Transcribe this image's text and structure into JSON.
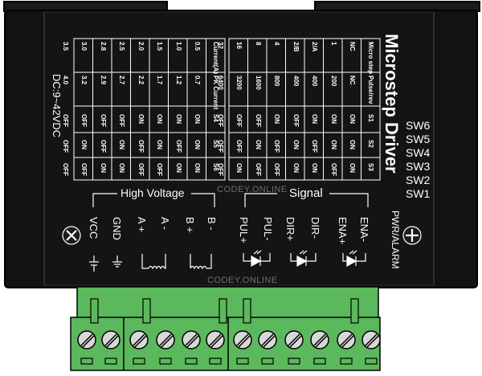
{
  "device": {
    "title": "Microstep Driver",
    "input_voltage": "DC:9~42VDC",
    "pwr_alarm": "PWR/ALARM",
    "watermark": "CODEY.ONLINE"
  },
  "switch_labels": [
    "SW6",
    "SW5",
    "SW4",
    "SW3",
    "SW2",
    "SW1"
  ],
  "current_table": {
    "headers": [
      "Current(A)",
      "PK Current",
      "S4",
      "S5",
      "S6"
    ],
    "rows": [
      [
        "0.5",
        "0.7",
        "ON",
        "ON",
        "ON"
      ],
      [
        "1.0",
        "1.2",
        "ON",
        "OFF",
        "ON"
      ],
      [
        "1.5",
        "1.7",
        "ON",
        "ON",
        "OFF"
      ],
      [
        "2.0",
        "2.2",
        "ON",
        "OFF",
        "OFF"
      ],
      [
        "2.5",
        "2.7",
        "OFF",
        "ON",
        "ON"
      ],
      [
        "2.8",
        "2.9",
        "OFF",
        "OFF",
        "ON"
      ],
      [
        "3.0",
        "3.2",
        "OFF",
        "ON",
        "OFF"
      ],
      [
        "3.5",
        "4.0",
        "OFF",
        "OFF",
        "OFF"
      ]
    ]
  },
  "microstep_table": {
    "headers": [
      "Micro step",
      "Pulse/rev",
      "S1",
      "S2",
      "S3"
    ],
    "rows": [
      [
        "NC",
        "NC",
        "ON",
        "ON",
        "ON"
      ],
      [
        "1",
        "200",
        "ON",
        "ON",
        "OFF"
      ],
      [
        "2/A",
        "400",
        "ON",
        "OFF",
        "ON"
      ],
      [
        "2/B",
        "400",
        "OFF",
        "ON",
        "ON"
      ],
      [
        "4",
        "800",
        "ON",
        "OFF",
        "OFF"
      ],
      [
        "8",
        "1600",
        "OFF",
        "ON",
        "OFF"
      ],
      [
        "16",
        "3200",
        "OFF",
        "OFF",
        "ON"
      ],
      [
        "32",
        "6400",
        "OFF",
        "OFF",
        "OFF"
      ]
    ]
  },
  "groups": {
    "high_voltage": "High Voltage",
    "signal": "Signal"
  },
  "terminals": [
    "VCC",
    "GND",
    "A +",
    "A -",
    "B +",
    "B -",
    "PUL+",
    "PUL-",
    "DIR+",
    "DIR-",
    "ENA+",
    "ENA-"
  ],
  "colors": {
    "body": "#111111",
    "outline": "#000000",
    "connector": "#5cb85c",
    "connector_dark": "#2e7d32",
    "screw": "#d7d7d7",
    "text": "#ffffff"
  },
  "icons": [
    "screw-icon",
    "inductor-icon",
    "optocoupler-icon",
    "ground-icon"
  ]
}
